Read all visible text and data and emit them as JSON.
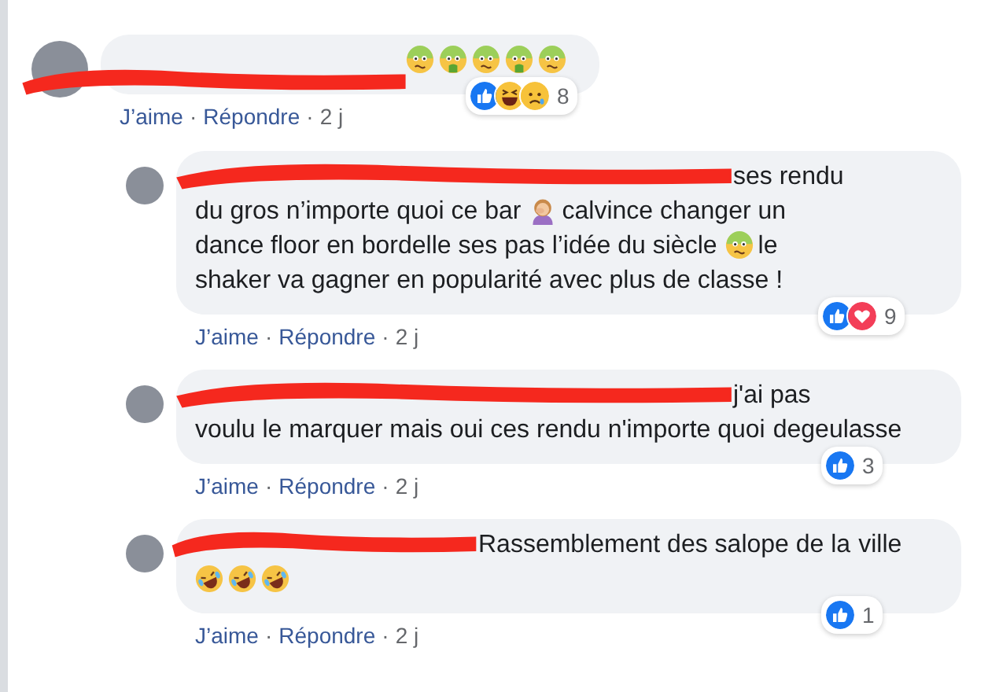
{
  "comments": [
    {
      "body": [
        {
          "kind": "nauseated"
        },
        {
          "kind": "vomiting"
        },
        {
          "kind": "nauseated"
        },
        {
          "kind": "vomiting"
        },
        {
          "kind": "nauseated"
        }
      ],
      "reactions": [
        {
          "kind": "like"
        },
        {
          "kind": "haha"
        },
        {
          "kind": "sad"
        }
      ],
      "reaction_count": "8",
      "actions": [
        {
          "kind": "link",
          "text": "J’aime"
        },
        {
          "kind": "separator",
          "text": "·"
        },
        {
          "kind": "link",
          "text": "Répondre"
        },
        {
          "kind": "separator",
          "text": "·"
        },
        {
          "kind": "time",
          "text": "2 j"
        }
      ],
      "replies": [
        {
          "body": [
            {
              "kind": "text",
              "text": "ses rendu"
            },
            {
              "kind": "text",
              "text": "du gros n’importe quoi ce bar"
            },
            {
              "kind": "facepalm"
            },
            {
              "kind": "text",
              "text": "calvince changer un"
            },
            {
              "kind": "text",
              "text": "dance floor en bordelle ses pas l’idée du siècle"
            },
            {
              "kind": "nauseated"
            },
            {
              "kind": "text",
              "text": "le"
            },
            {
              "kind": "text",
              "text": "shaker va gagner en popularité avec plus de classe !"
            }
          ],
          "reactions": [
            {
              "kind": "like"
            },
            {
              "kind": "love"
            }
          ],
          "reaction_count": "9",
          "actions": [
            {
              "kind": "link",
              "text": "J’aime"
            },
            {
              "kind": "separator",
              "text": "·"
            },
            {
              "kind": "link",
              "text": "Répondre"
            },
            {
              "kind": "separator",
              "text": "·"
            },
            {
              "kind": "time",
              "text": "2 j"
            }
          ]
        },
        {
          "body": [
            {
              "kind": "text",
              "text": "j'ai pas"
            },
            {
              "kind": "text",
              "text": "voulu le marquer mais oui ces rendu n'importe quoi"
            },
            {
              "kind": "text",
              "text": "degeulasse"
            }
          ],
          "reactions": [
            {
              "kind": "like"
            }
          ],
          "reaction_count": "3",
          "actions": [
            {
              "kind": "link",
              "text": "J’aime"
            },
            {
              "kind": "separator",
              "text": "·"
            },
            {
              "kind": "link",
              "text": "Répondre"
            },
            {
              "kind": "separator",
              "text": "·"
            },
            {
              "kind": "time",
              "text": "2 j"
            }
          ]
        },
        {
          "body": [
            {
              "kind": "text",
              "text": "Rassemblement des salope de la"
            },
            {
              "kind": "text",
              "text": "ville"
            },
            {
              "kind": "rofl"
            },
            {
              "kind": "rofl"
            },
            {
              "kind": "rofl"
            }
          ],
          "reactions": [
            {
              "kind": "like"
            }
          ],
          "reaction_count": "1",
          "actions": [
            {
              "kind": "link",
              "text": "J’aime"
            },
            {
              "kind": "separator",
              "text": "·"
            },
            {
              "kind": "link",
              "text": "Répondre"
            },
            {
              "kind": "separator",
              "text": "·"
            },
            {
              "kind": "time",
              "text": "2 j"
            }
          ]
        }
      ]
    }
  ]
}
